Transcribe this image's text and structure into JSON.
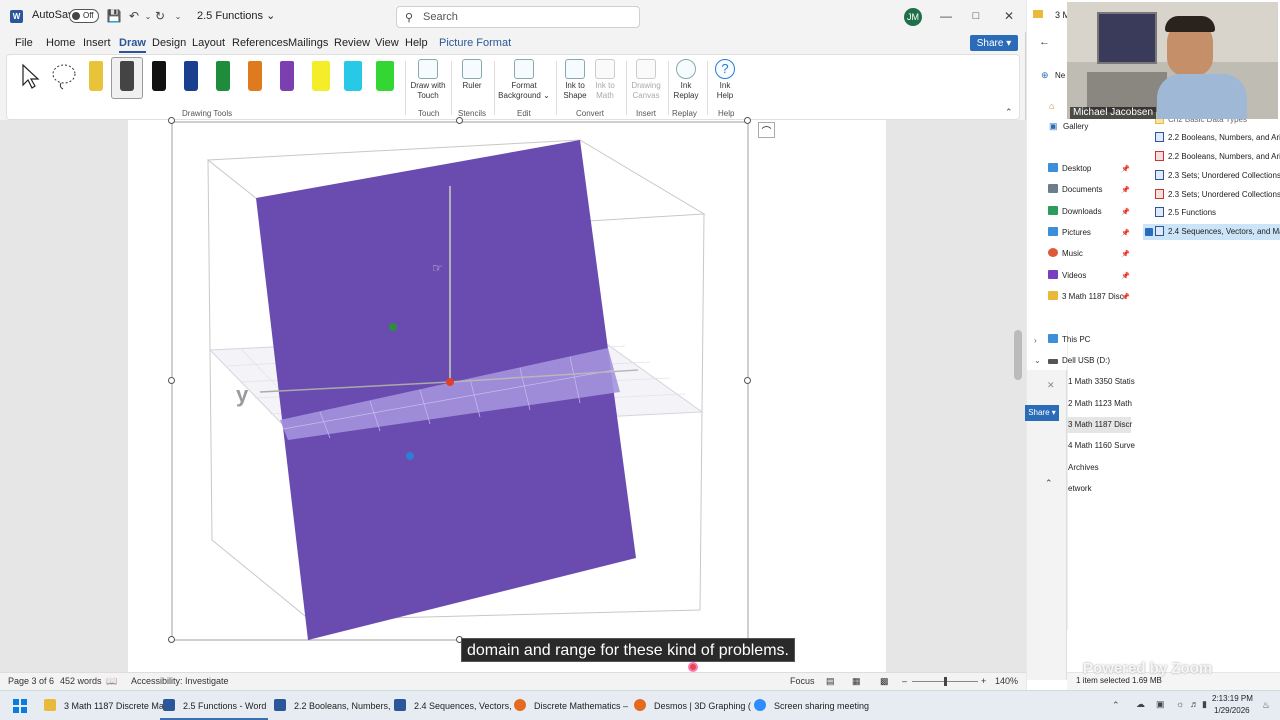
{
  "word": {
    "autosave_label": "AutoSave",
    "autosave_state": "Off",
    "doc_title": "2.5 Functions",
    "search_placeholder": "Search",
    "user_initials": "JM",
    "menu": [
      "File",
      "Home",
      "Insert",
      "Draw",
      "Design",
      "Layout",
      "References",
      "Mailings",
      "Review",
      "View",
      "Help",
      "Picture Format"
    ],
    "active_menu": "Draw",
    "share_label": "Share",
    "ribbon": {
      "drawing_tools_label": "Drawing Tools",
      "pen_colors": [
        "#e8c43a",
        "#444444",
        "#111111",
        "#1b3f8f",
        "#1e8c3a",
        "#e07a1f",
        "#7b3fb0",
        "#f4ee2a",
        "#27c9e6",
        "#33d633"
      ],
      "buttons": [
        {
          "line1": "Draw with",
          "line2": "Touch",
          "group": "Touch",
          "icon": "hand-draw-icon",
          "disabled": false
        },
        {
          "line1": "Ruler",
          "line2": "",
          "group": "Stencils",
          "icon": "ruler-icon",
          "disabled": false
        },
        {
          "line1": "Format",
          "line2": "Background",
          "group": "Edit",
          "icon": "format-background-icon",
          "disabled": false
        },
        {
          "line1": "Ink to",
          "line2": "Shape",
          "group": "Convert",
          "icon": "ink-to-shape-icon",
          "disabled": false
        },
        {
          "line1": "Ink to",
          "line2": "Math",
          "group": "",
          "icon": "ink-to-math-icon",
          "disabled": true
        },
        {
          "line1": "Drawing",
          "line2": "Canvas",
          "group": "Insert",
          "icon": "drawing-canvas-icon",
          "disabled": true
        },
        {
          "line1": "Ink",
          "line2": "Replay",
          "group": "Replay",
          "icon": "ink-replay-icon",
          "disabled": false
        },
        {
          "line1": "Ink",
          "line2": "Help",
          "group": "Help",
          "icon": "help-icon",
          "disabled": false
        }
      ]
    },
    "status": {
      "page": "Page 3 of 6",
      "words": "452 words",
      "accessibility": "Accessibility: Investigate",
      "focus": "Focus",
      "zoom": "140%"
    },
    "caption": "domain and range for these kind of problems.",
    "graph_axis_label": "y",
    "colors": {
      "plane": "#6a4bb0",
      "accent": "#2b579a"
    }
  },
  "explorer": {
    "webcam_name": "Michael Jacobsen",
    "top_label": "3 M",
    "new_label": "Ne",
    "gallery": "Gallery",
    "quick_access": [
      {
        "label": "Desktop",
        "color": "#3a8fd8"
      },
      {
        "label": "Documents",
        "color": "#6d7c8a"
      },
      {
        "label": "Downloads",
        "color": "#2a9d5b"
      },
      {
        "label": "Pictures",
        "color": "#3a8fd8"
      },
      {
        "label": "Music",
        "color": "#e0583a"
      },
      {
        "label": "Videos",
        "color": "#7a3fc0"
      },
      {
        "label": "3 Math 1187 Disc",
        "color": "#e8b93a"
      }
    ],
    "this_pc": "This PC",
    "usb": "Dell USB (D:)",
    "usb_folders": [
      "1 Math 3350 Statis",
      "2 Math 1123 Math",
      "3 Math 1187 Discr",
      "4 Math 1160 Surve",
      "Archives",
      "etwork"
    ],
    "files": [
      {
        "name": "Ch2 Basic Data Types",
        "type": "folder"
      },
      {
        "name": "2.2 Booleans, Numbers, and Ari",
        "type": "word"
      },
      {
        "name": "2.2 Booleans, Numbers, and Ari",
        "type": "pdf"
      },
      {
        "name": "2.3 Sets; Unordered Collections",
        "type": "word"
      },
      {
        "name": "2.3 Sets; Unordered Collections",
        "type": "pdf"
      },
      {
        "name": "2.5 Functions",
        "type": "word"
      },
      {
        "name": "2.4 Sequences, Vectors, and Mat",
        "type": "word"
      }
    ],
    "share_label": "Share",
    "status": "1 item selected  1.69 MB",
    "watermark": "Powered by Zoom"
  },
  "taskbar": {
    "items": [
      {
        "label": "3 Math 1187 Discrete Ma",
        "color": "#e8b93a"
      },
      {
        "label": "2.5 Functions - Word",
        "color": "#2b579a"
      },
      {
        "label": "2.2 Booleans, Numbers,",
        "color": "#2b579a"
      },
      {
        "label": "2.4 Sequences, Vectors,",
        "color": "#2b579a"
      },
      {
        "label": "Discrete Mathematics –",
        "color": "#e56a1f"
      },
      {
        "label": "Desmos | 3D Graphing (",
        "color": "#e56a1f"
      },
      {
        "label": "Screen sharing meeting",
        "color": "#2d8cff"
      }
    ],
    "time": "2:13:19 PM",
    "date": "1/29/2026"
  }
}
